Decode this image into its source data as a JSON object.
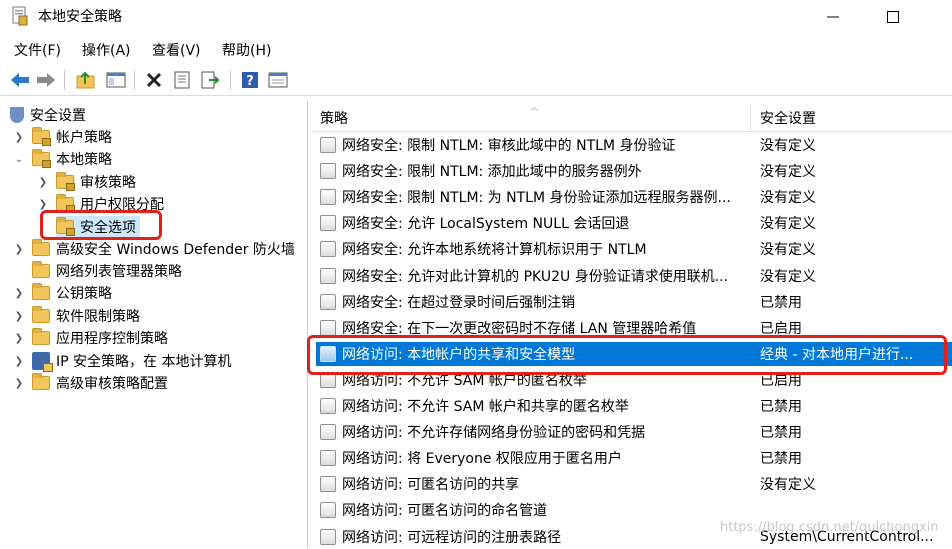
{
  "window": {
    "title": "本地安全策略"
  },
  "menu": [
    "文件(F)",
    "操作(A)",
    "查看(V)",
    "帮助(H)"
  ],
  "toolbar": [
    "back-icon",
    "forward-icon",
    "up-folder-icon",
    "show-hide-tree-icon",
    "delete-icon",
    "properties-icon",
    "export-list-icon",
    "help-icon",
    "view-icon"
  ],
  "tree": {
    "root": "安全设置",
    "account_policy": "帐户策略",
    "local_policy": "本地策略",
    "audit_policy": "审核策略",
    "user_rights": "用户权限分配",
    "security_options": "安全选项",
    "firewall": "高级安全 Windows Defender 防火墙",
    "network_list": "网络列表管理器策略",
    "public_key": "公钥策略",
    "software_restriction": "软件限制策略",
    "app_control": "应用程序控制策略",
    "ip_security": "IP 安全策略，在 本地计算机",
    "advanced_audit": "高级审核策略配置"
  },
  "list": {
    "col_policy": "策略",
    "col_setting": "安全设置",
    "rows": [
      {
        "policy": "网络安全: 限制 NTLM: 审核此域中的 NTLM 身份验证",
        "setting": "没有定义"
      },
      {
        "policy": "网络安全: 限制 NTLM: 添加此域中的服务器例外",
        "setting": "没有定义"
      },
      {
        "policy": "网络安全: 限制 NTLM: 为 NTLM 身份验证添加远程服务器例...",
        "setting": "没有定义"
      },
      {
        "policy": "网络安全: 允许 LocalSystem NULL 会话回退",
        "setting": "没有定义"
      },
      {
        "policy": "网络安全: 允许本地系统将计算机标识用于 NTLM",
        "setting": "没有定义"
      },
      {
        "policy": "网络安全: 允许对此计算机的 PKU2U 身份验证请求使用联机...",
        "setting": "没有定义"
      },
      {
        "policy": "网络安全: 在超过登录时间后强制注销",
        "setting": "已禁用"
      },
      {
        "policy": "网络安全: 在下一次更改密码时不存储 LAN 管理器哈希值",
        "setting": "已启用"
      },
      {
        "policy": "网络访问: 本地帐户的共享和安全模型",
        "setting": "经典 - 对本地用户进行..."
      },
      {
        "policy": "网络访问: 不允许 SAM 帐户的匿名枚举",
        "setting": "已启用"
      },
      {
        "policy": "网络访问: 不允许 SAM 帐户和共享的匿名枚举",
        "setting": "已禁用"
      },
      {
        "policy": "网络访问: 不允许存储网络身份验证的密码和凭据",
        "setting": "已禁用"
      },
      {
        "policy": "网络访问: 将 Everyone 权限应用于匿名用户",
        "setting": "已禁用"
      },
      {
        "policy": "网络访问: 可匿名访问的共享",
        "setting": "没有定义"
      },
      {
        "policy": "网络访问: 可匿名访问的命名管道",
        "setting": ""
      },
      {
        "policy": "网络访问: 可远程访问的注册表路径",
        "setting": "System\\CurrentControl..."
      }
    ]
  },
  "watermark": "https://blog.csdn.net/qulchongxin",
  "colors": {
    "selection": "#0078d7",
    "highlight_box": "#e0201b"
  }
}
